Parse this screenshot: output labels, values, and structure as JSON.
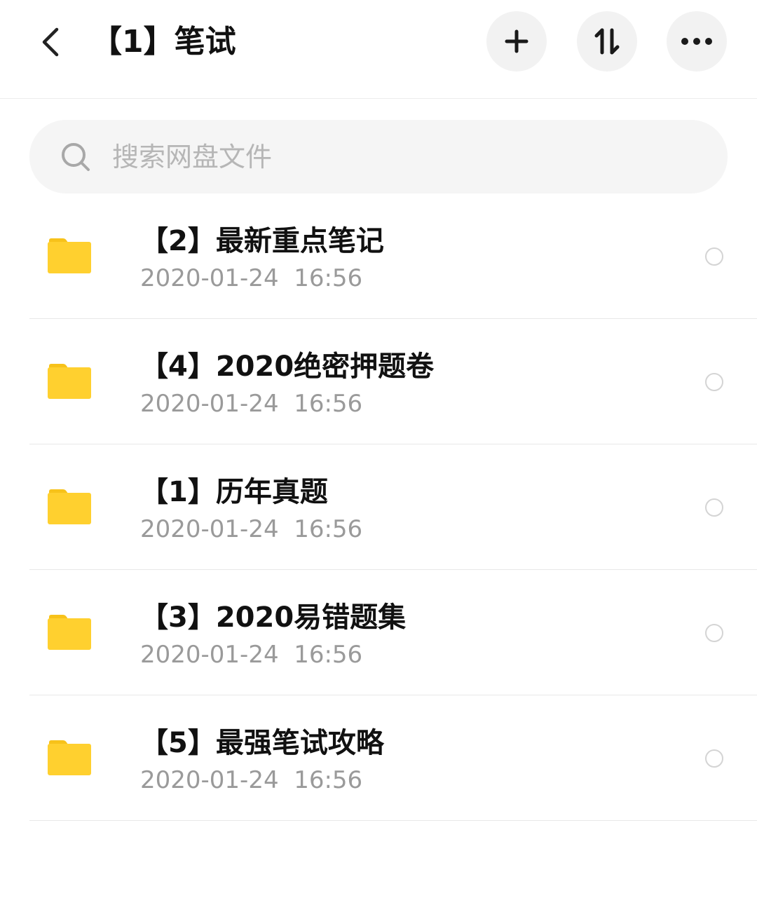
{
  "header": {
    "title": "【1】笔试",
    "back_icon": "chevron-left-icon",
    "actions": [
      {
        "name": "add",
        "icon": "plus-icon"
      },
      {
        "name": "sort",
        "icon": "sort-arrows-icon"
      },
      {
        "name": "more",
        "icon": "more-dots-icon"
      }
    ]
  },
  "search": {
    "placeholder": "搜索网盘文件",
    "icon": "search-icon"
  },
  "files": [
    {
      "name": "【2】最新重点笔记",
      "date": "2020-01-24  16:56",
      "type": "folder"
    },
    {
      "name": "【4】2020绝密押题卷",
      "date": "2020-01-24  16:56",
      "type": "folder"
    },
    {
      "name": "【1】历年真题",
      "date": "2020-01-24  16:56",
      "type": "folder"
    },
    {
      "name": "【3】2020易错题集",
      "date": "2020-01-24  16:56",
      "type": "folder"
    },
    {
      "name": "【5】最强笔试攻略",
      "date": "2020-01-24  16:56",
      "type": "folder"
    }
  ],
  "colors": {
    "folder": "#FFD02F",
    "folder_tab": "#F7C21A",
    "text_primary": "#111111",
    "text_secondary": "#9A9A9A",
    "button_bg": "#F2F2F2",
    "search_bg": "#F5F5F5"
  }
}
